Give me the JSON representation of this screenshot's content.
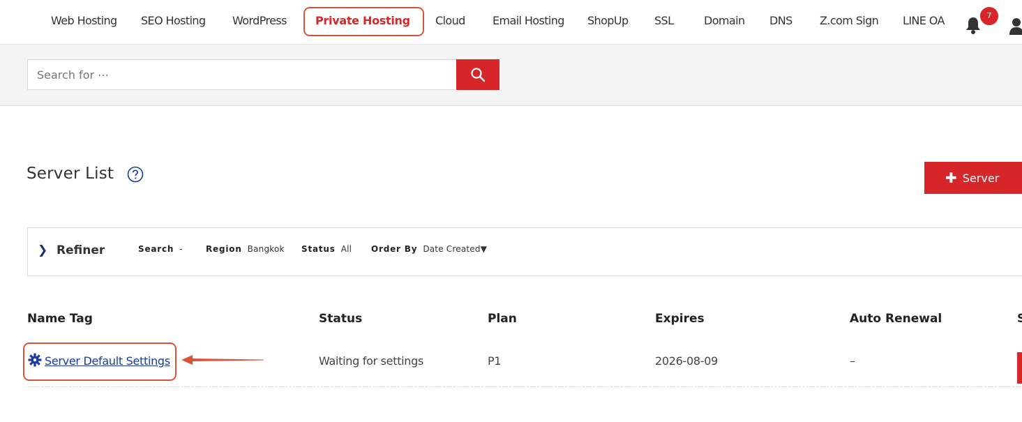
{
  "nav": {
    "items": [
      {
        "label": "Web Hosting",
        "active": false
      },
      {
        "label": "SEO Hosting",
        "active": false
      },
      {
        "label": "WordPress",
        "active": false
      },
      {
        "label": "Private Hosting",
        "active": true
      },
      {
        "label": "Cloud",
        "active": false
      },
      {
        "label": "Email Hosting",
        "active": false
      },
      {
        "label": "ShopUp",
        "active": false
      },
      {
        "label": "SSL",
        "active": false
      },
      {
        "label": "Domain",
        "active": false
      },
      {
        "label": "DNS",
        "active": false
      },
      {
        "label": "Z.com Sign",
        "active": false
      },
      {
        "label": "LINE OA",
        "active": false
      }
    ],
    "notification_count": "7"
  },
  "search": {
    "placeholder": "Search for ⋯",
    "button_icon": "search-icon"
  },
  "page": {
    "title": "Server List",
    "help_icon": "help-circle-icon",
    "add_button_label": "Server"
  },
  "refiner": {
    "title": "Refiner",
    "filters": [
      {
        "key": "Search",
        "value": "-"
      },
      {
        "key": "Region",
        "value": "Bangkok"
      },
      {
        "key": "Status",
        "value": "All"
      },
      {
        "key": "Order By",
        "value": "Date Created▼"
      }
    ]
  },
  "table": {
    "columns": [
      "Name Tag",
      "Status",
      "Plan",
      "Expires",
      "Auto Renewal",
      "S"
    ],
    "rows": [
      {
        "name_tag": "Server Default Settings",
        "status": "Waiting for settings",
        "plan": "P1",
        "expires": "2026-08-09",
        "auto_renewal": "–"
      }
    ]
  },
  "colors": {
    "accent": "#d6262a",
    "link": "#1a3aa0",
    "annotation": "#d9533a"
  }
}
